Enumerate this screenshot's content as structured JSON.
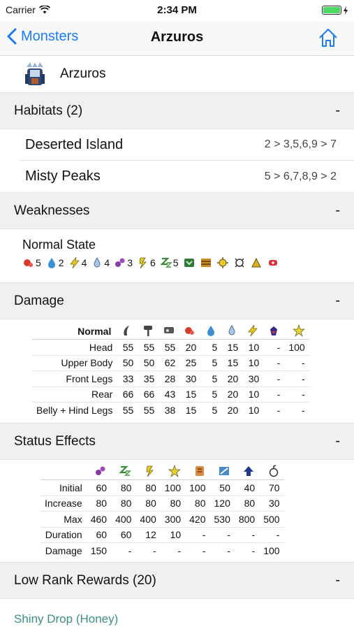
{
  "status_bar": {
    "carrier": "Carrier",
    "time": "2:34 PM"
  },
  "nav": {
    "back_label": "Monsters",
    "title": "Arzuros"
  },
  "monster": {
    "name": "Arzuros"
  },
  "habitats": {
    "header": "Habitats (2)",
    "toggle": "-",
    "items": [
      {
        "name": "Deserted Island",
        "zones": "2 > 3,5,6,9 > 7"
      },
      {
        "name": "Misty Peaks",
        "zones": "5 > 6,7,8,9 > 2"
      }
    ]
  },
  "weaknesses": {
    "header": "Weaknesses",
    "toggle": "-",
    "state": "Normal State",
    "items": [
      {
        "icon": "fire-icon",
        "value": "5"
      },
      {
        "icon": "water-icon",
        "value": "2"
      },
      {
        "icon": "thunder-icon",
        "value": "4"
      },
      {
        "icon": "ice-icon",
        "value": "4"
      },
      {
        "icon": "poison-icon",
        "value": "3"
      },
      {
        "icon": "paralysis-icon",
        "value": "6"
      },
      {
        "icon": "sleep-icon",
        "value": "5"
      },
      {
        "icon": "trap-icon",
        "value": ""
      },
      {
        "icon": "pitfall-icon",
        "value": ""
      },
      {
        "icon": "flash-bomb-icon",
        "value": ""
      },
      {
        "icon": "sonic-bomb-icon",
        "value": ""
      },
      {
        "icon": "dung-bomb-icon",
        "value": ""
      },
      {
        "icon": "meat-icon",
        "value": ""
      }
    ]
  },
  "damage": {
    "header": "Damage",
    "toggle": "-",
    "state_label": "Normal",
    "columns": [
      "cut-icon",
      "impact-icon",
      "shot-icon",
      "fire-icon",
      "water-icon",
      "ice-icon",
      "thunder-icon",
      "dragon-icon",
      "stun-icon"
    ],
    "rows": [
      {
        "part": "Head",
        "values": [
          "55",
          "55",
          "55",
          "20",
          "5",
          "15",
          "10",
          "-",
          "100"
        ]
      },
      {
        "part": "Upper Body",
        "values": [
          "50",
          "50",
          "62",
          "25",
          "5",
          "15",
          "10",
          "-",
          "-"
        ]
      },
      {
        "part": "Front Legs",
        "values": [
          "33",
          "35",
          "28",
          "30",
          "5",
          "20",
          "30",
          "-",
          "-"
        ]
      },
      {
        "part": "Rear",
        "values": [
          "66",
          "66",
          "43",
          "15",
          "5",
          "20",
          "10",
          "-",
          "-"
        ]
      },
      {
        "part": "Belly + Hind Legs",
        "values": [
          "55",
          "55",
          "38",
          "15",
          "5",
          "20",
          "10",
          "-",
          "-"
        ]
      }
    ]
  },
  "status_effects": {
    "header": "Status Effects",
    "toggle": "-",
    "columns": [
      "poison-icon",
      "sleep-icon",
      "paralysis-icon",
      "stun-icon",
      "exhaust-icon",
      "mount-icon",
      "jump-icon",
      "blast-icon"
    ],
    "rows": [
      {
        "label": "Initial",
        "values": [
          "60",
          "80",
          "80",
          "100",
          "100",
          "50",
          "40",
          "70"
        ]
      },
      {
        "label": "Increase",
        "values": [
          "80",
          "80",
          "80",
          "80",
          "80",
          "120",
          "80",
          "30"
        ]
      },
      {
        "label": "Max",
        "values": [
          "460",
          "400",
          "400",
          "300",
          "420",
          "530",
          "800",
          "500"
        ]
      },
      {
        "label": "Duration",
        "values": [
          "60",
          "60",
          "12",
          "10",
          "-",
          "-",
          "-",
          "-"
        ]
      },
      {
        "label": "Damage",
        "values": [
          "150",
          "-",
          "-",
          "-",
          "-",
          "-",
          "-",
          "100"
        ]
      }
    ]
  },
  "rewards": {
    "header": "Low Rank Rewards (20)",
    "toggle": "-",
    "first_item": "Shiny Drop (Honey)"
  },
  "colors": {
    "accent": "#1a7cf5",
    "link": "#3a8f83",
    "section_bg": "#f0f0f0",
    "battery": "#4cd964"
  }
}
